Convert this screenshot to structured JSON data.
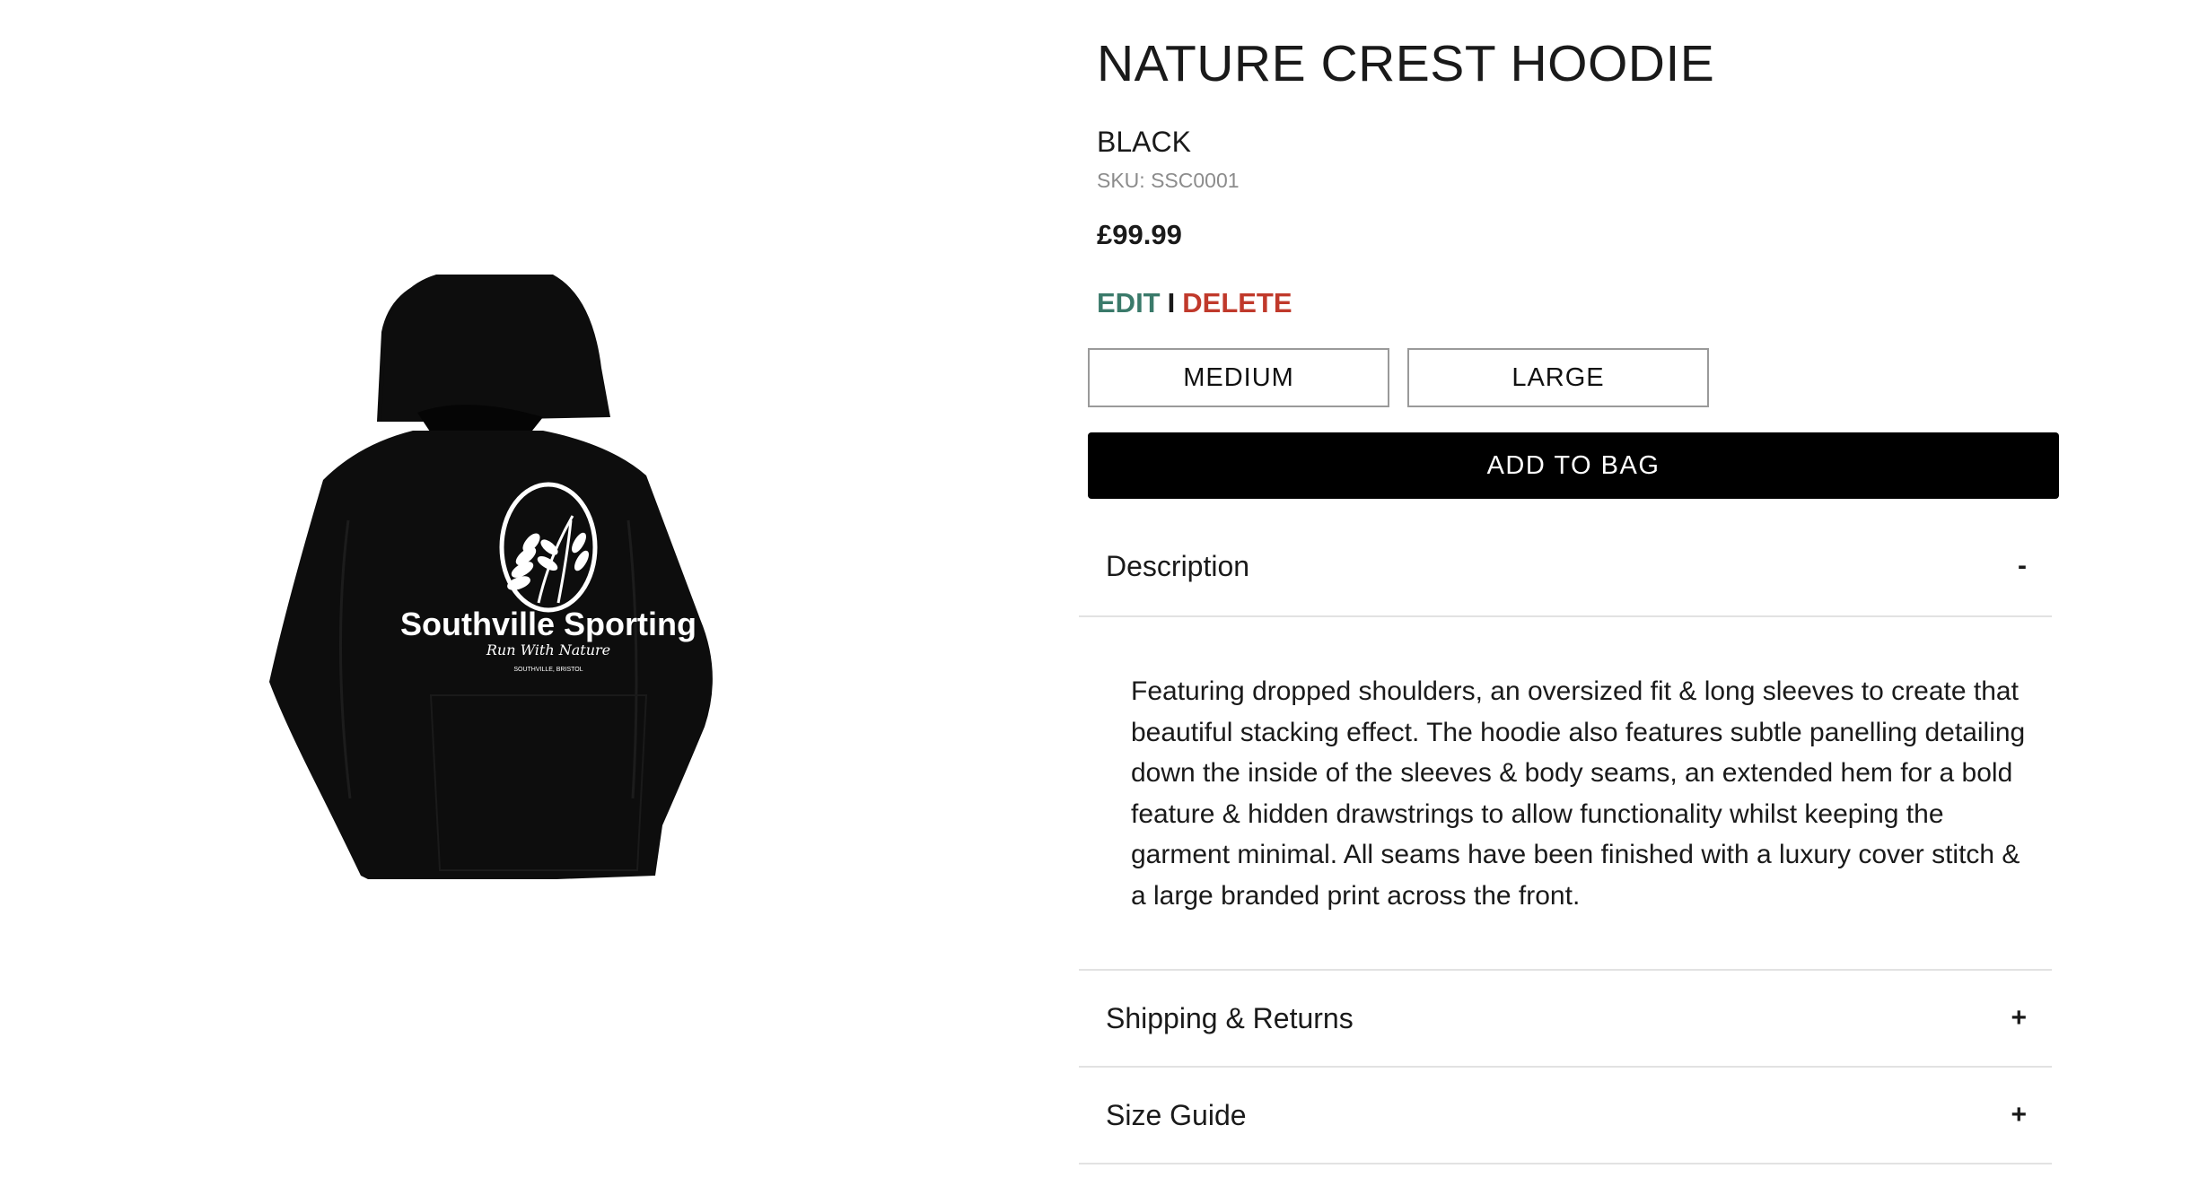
{
  "product": {
    "title": "NATURE CREST HOODIE",
    "color": "BLACK",
    "sku": "SKU: SSC0001",
    "price": "£99.99",
    "image": {
      "brand_text": "Southville Sporting",
      "tagline": "Run With Nature",
      "location": "SOUTHVILLE, BRISTOL",
      "garment_color": "#0d0d0d",
      "print_color": "#ffffff"
    }
  },
  "admin": {
    "edit_label": "EDIT",
    "separator": "I",
    "delete_label": "DELETE",
    "edit_color": "#3a7a6a",
    "delete_color": "#c0392b"
  },
  "sizes": [
    "MEDIUM",
    "LARGE"
  ],
  "add_to_bag_label": "ADD TO BAG",
  "accordion": {
    "description": {
      "label": "Description",
      "toggle": "-",
      "body": "Featuring dropped shoulders, an oversized fit & long sleeves to create that beautiful stacking effect. The hoodie also features subtle panelling detailing down the inside of the sleeves & body seams, an extended hem for a bold feature & hidden drawstrings to allow functionality whilst keeping the garment minimal. All seams have been finished with a luxury cover stitch & a large branded print across the front."
    },
    "shipping": {
      "label": "Shipping & Returns",
      "toggle": "+"
    },
    "size_guide": {
      "label": "Size Guide",
      "toggle": "+"
    }
  }
}
